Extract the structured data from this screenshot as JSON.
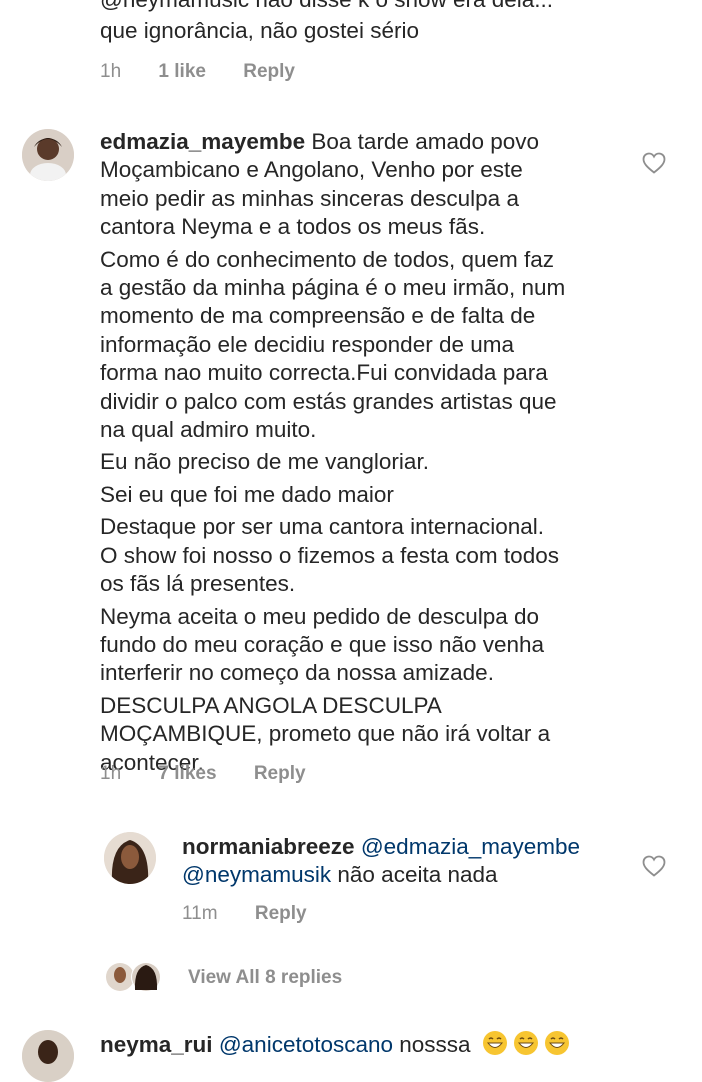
{
  "top_comment": {
    "line_partial": "@neymamusic  não disse k o show era dela...",
    "line2": "que ignorância,  não gostei sério",
    "time": "1h",
    "likes": "1 like",
    "reply": "Reply"
  },
  "main_comment": {
    "username": "edmazia_mayembe",
    "lines": [
      "Boa tarde amado povo",
      "Moçambicano e Angolano, Venho por este",
      "meio pedir as minhas sinceras desculpa a",
      "cantora Neyma e a todos os meus fãs.",
      "Como é do conhecimento de todos, quem faz",
      "a gestão da minha página é o meu irmão, num",
      "momento de ma compreensão e de falta de",
      "informação ele decidiu responder de uma",
      "forma nao muito correcta.Fui convidada para",
      "dividir o palco com estás grandes artistas que",
      "na qual admiro muito.",
      "Eu não preciso de me vangloriar.",
      "Sei eu que foi me dado maior",
      "Destaque por ser uma cantora internacional.",
      "O show foi nosso o fizemos a festa com todos",
      "os fãs lá presentes.",
      "Neyma aceita o meu pedido de desculpa do",
      "fundo do meu coração e que isso não venha",
      "interferir no começo da nossa amizade.",
      "DESCULPA ANGOLA DESCULPA",
      "MOÇAMBIQUE, prometo que não irá voltar a",
      "acontecer."
    ],
    "time": "1h",
    "likes": "7 likes",
    "reply": "Reply"
  },
  "reply_comment": {
    "username": "normaniabreeze",
    "mention1": "@edmazia_mayembe",
    "mention2": "@neymamusik",
    "text": " não aceita nada",
    "time": "11m",
    "reply": "Reply"
  },
  "view_replies": "View All 8 replies",
  "bottom_comment": {
    "username": "neyma_rui",
    "mention": "@anicetotoscano",
    "text": " nosssa"
  },
  "colors": {
    "text": "#262626",
    "meta": "#8e8e8e",
    "mention": "#00376b"
  }
}
